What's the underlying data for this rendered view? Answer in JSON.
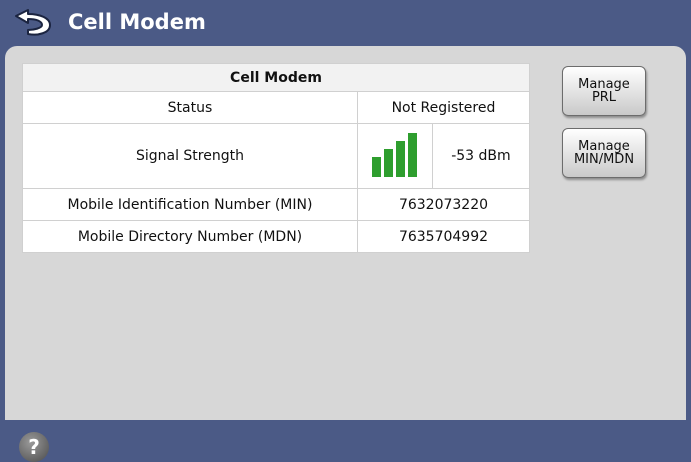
{
  "header": {
    "title": "Cell Modem",
    "back_icon": "back-arrow-icon"
  },
  "table": {
    "heading": "Cell Modem",
    "status": {
      "label": "Status",
      "value": "Not Registered"
    },
    "signal": {
      "label": "Signal Strength",
      "value": "-53 dBm",
      "bars_lit": 4,
      "bars_total": 4,
      "bar_color": "#2e9e2e"
    },
    "min": {
      "label": "Mobile Identification Number (MIN)",
      "value": "7632073220"
    },
    "mdn": {
      "label": "Mobile Directory Number (MDN)",
      "value": "7635704992"
    }
  },
  "buttons": {
    "manage_prl": {
      "line1": "Manage",
      "line2": "PRL"
    },
    "manage_min_mdn": {
      "line1": "Manage",
      "line2": "MIN/MDN"
    }
  },
  "help": {
    "symbol": "?",
    "icon": "help-icon"
  },
  "colors": {
    "header_bg": "#4b5a86",
    "panel_bg": "#d7d7d7"
  }
}
